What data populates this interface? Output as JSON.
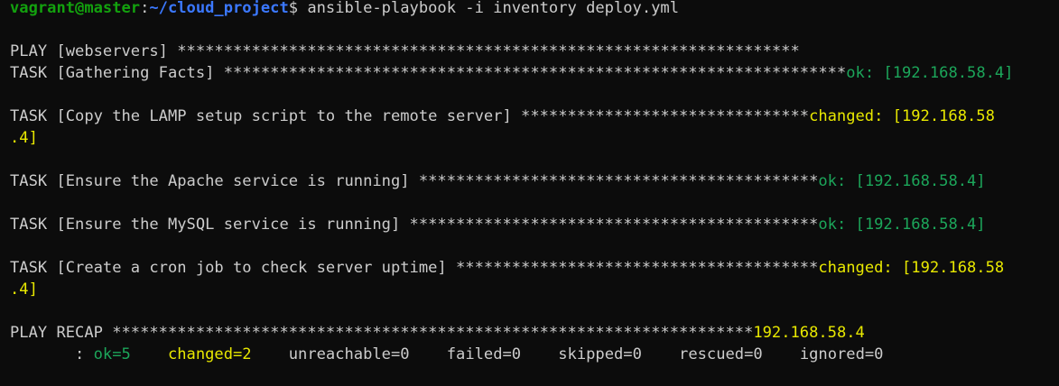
{
  "prompt": {
    "user_host": "vagrant@master",
    "separator": ":",
    "path": "~/cloud_project",
    "symbol": "$",
    "command": " ansible-playbook -i inventory deploy.yml"
  },
  "play": {
    "label": "PLAY [webservers] ",
    "stars": "*******************************************************************"
  },
  "tasks": [
    {
      "label": "TASK [Gathering Facts] ",
      "stars": "*******************************************************************",
      "status": "ok: [192.168.58.4]",
      "status_type": "ok",
      "continuation": ""
    },
    {
      "label": "TASK [Copy the LAMP setup script to the remote server] ",
      "stars": "*******************************",
      "status": "changed: [192.168.58",
      "status_type": "changed",
      "continuation": ".4]"
    },
    {
      "label": "TASK [Ensure the Apache service is running] ",
      "stars": "*******************************************",
      "status": "ok: [192.168.58.4]",
      "status_type": "ok",
      "continuation": ""
    },
    {
      "label": "TASK [Ensure the MySQL service is running] ",
      "stars": "********************************************",
      "status": "ok: [192.168.58.4]",
      "status_type": "ok",
      "continuation": ""
    },
    {
      "label": "TASK [Create a cron job to check server uptime] ",
      "stars": "***************************************",
      "status": "changed: [192.168.58",
      "status_type": "changed",
      "continuation": ".4]"
    }
  ],
  "recap": {
    "label": "PLAY RECAP ",
    "stars": "*********************************************************************",
    "host": "192.168.58.4",
    "indent": "       : ",
    "ok": "ok=5",
    "changed": "changed=2",
    "unreachable": "unreachable=0",
    "failed": "failed=0",
    "skipped": "skipped=0",
    "rescued": "rescued=0",
    "ignored": "ignored=0"
  },
  "colors": {
    "background": "#0c0c0c",
    "text": "#cccccc",
    "user": "#13a10e",
    "path": "#3b78ff",
    "ok": "#1ca65a",
    "changed": "#e8e800"
  }
}
